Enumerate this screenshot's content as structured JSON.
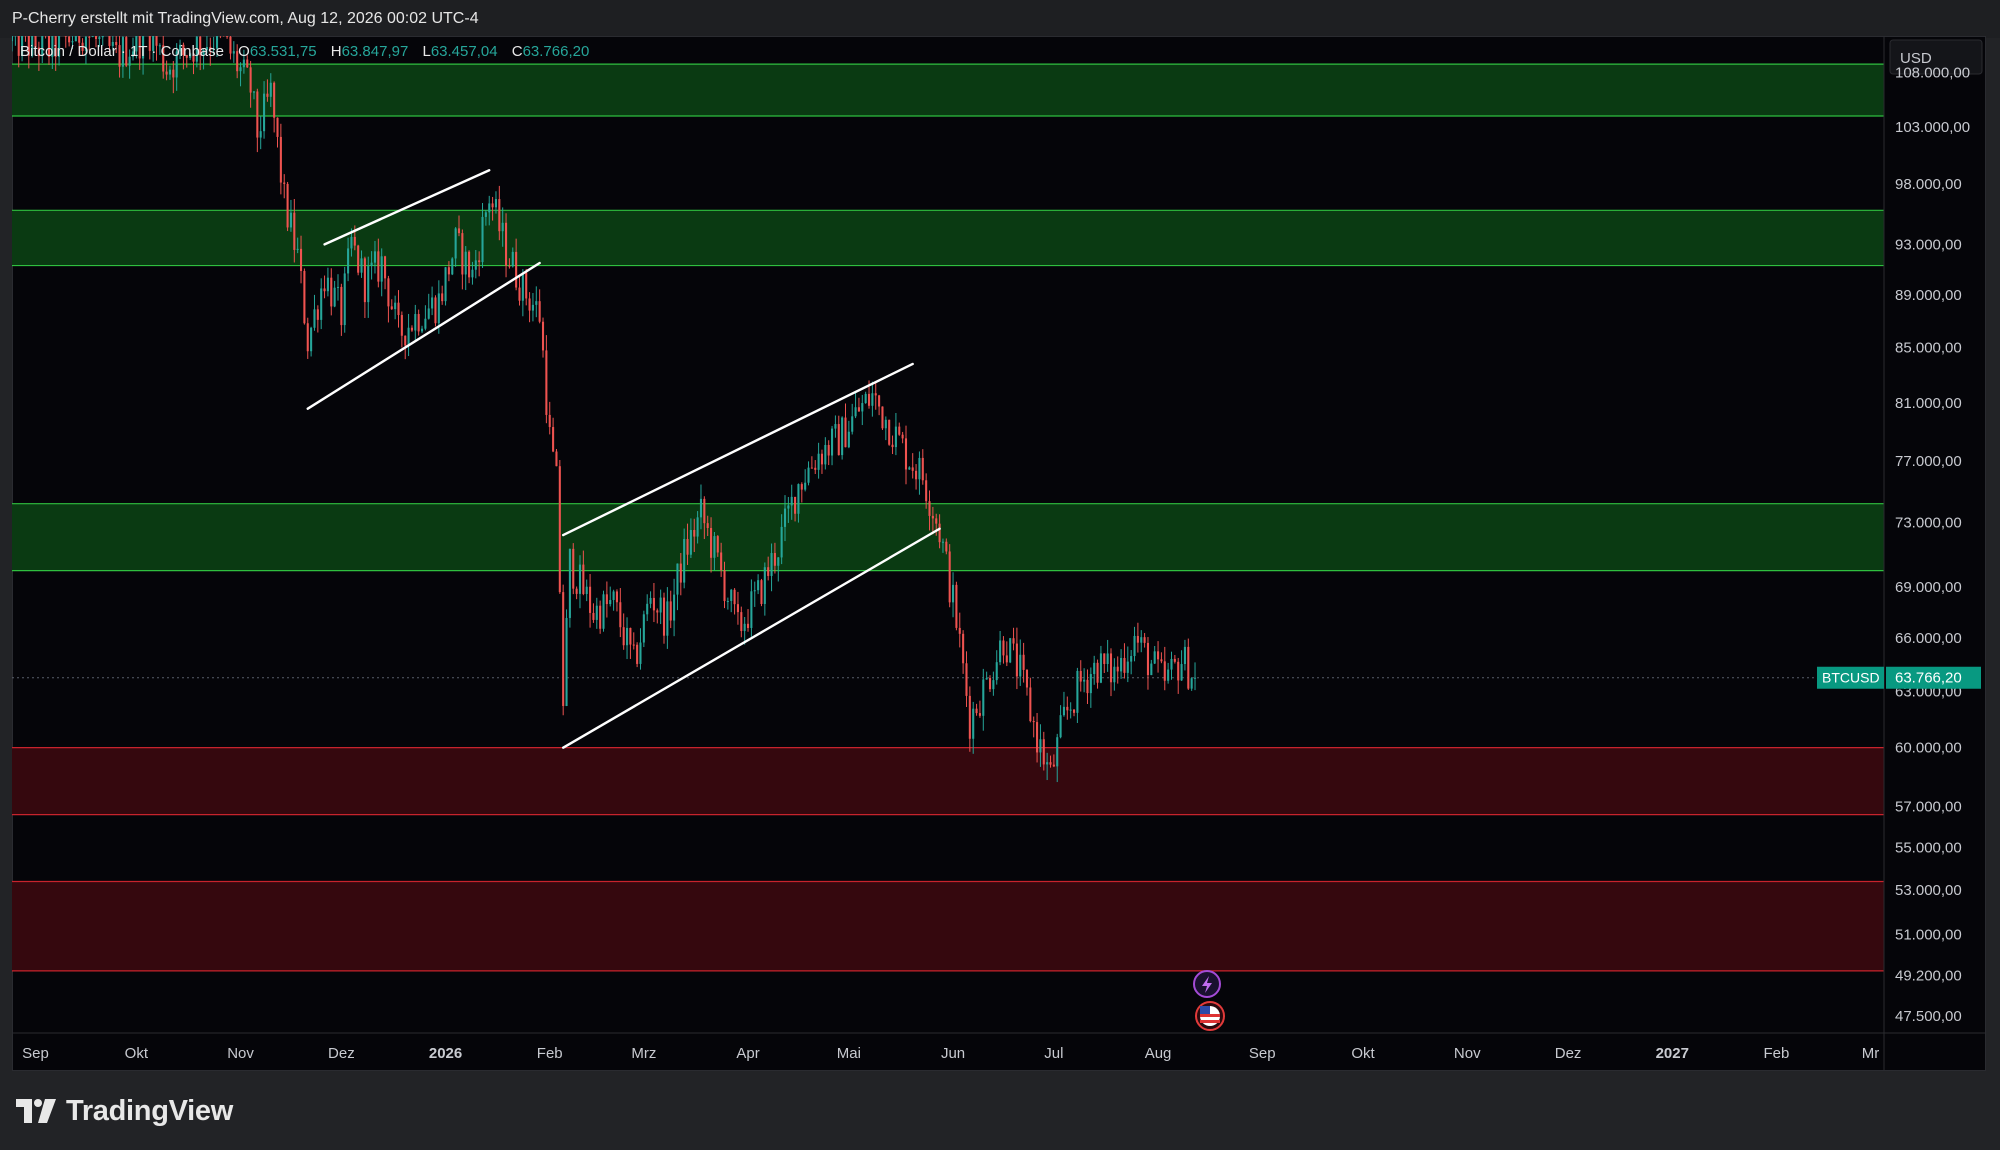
{
  "header": {
    "title": "P-Cherry erstellt mit TradingView.com, Aug 12, 2026 00:02 UTC-4"
  },
  "legend": {
    "symbol": "Bitcoin / Dollar · 1T · Coinbase",
    "o_label": "O",
    "o_value": "63.531,75",
    "h_label": "H",
    "h_value": "63.847,97",
    "l_label": "L",
    "l_value": "63.457,04",
    "c_label": "C",
    "c_value": "63.766,20"
  },
  "currency_label": "USD",
  "price_tag": {
    "symbol": "BTCUSD",
    "value": "63.766,20"
  },
  "brand": {
    "name": "TradingView"
  },
  "colors": {
    "up": "#26a69a",
    "down": "#ef5350",
    "support_zone": "#0a3a12",
    "support_border": "#2fbf3f",
    "resistance_zone": "#35080e",
    "resistance_border": "#c8232c",
    "tag_bg": "#089981"
  },
  "chart_data": {
    "type": "candlestick",
    "y_scale": "log",
    "ylim": [
      46800,
      111500
    ],
    "y_ticks": [
      {
        "value": 108000,
        "label": "108.000,00"
      },
      {
        "value": 103000,
        "label": "103.000,00"
      },
      {
        "value": 98000,
        "label": "98.000,00"
      },
      {
        "value": 93000,
        "label": "93.000,00"
      },
      {
        "value": 89000,
        "label": "89.000,00"
      },
      {
        "value": 85000,
        "label": "85.000,00"
      },
      {
        "value": 81000,
        "label": "81.000,00"
      },
      {
        "value": 77000,
        "label": "77.000,00"
      },
      {
        "value": 73000,
        "label": "73.000,00"
      },
      {
        "value": 69000,
        "label": "69.000,00"
      },
      {
        "value": 66000,
        "label": "66.000,00"
      },
      {
        "value": 63000,
        "label": "63.000,00"
      },
      {
        "value": 60000,
        "label": "60.000,00"
      },
      {
        "value": 57000,
        "label": "57.000,00"
      },
      {
        "value": 55000,
        "label": "55.000,00"
      },
      {
        "value": 53000,
        "label": "53.000,00"
      },
      {
        "value": 51000,
        "label": "51.000,00"
      },
      {
        "value": 49200,
        "label": "49.200,00"
      },
      {
        "value": 47500,
        "label": "47.500,00"
      }
    ],
    "x_range": [
      "2025-08-25",
      "2027-03-05"
    ],
    "x_ticks": [
      {
        "date": "2025-09-01",
        "label": "Sep",
        "bold": false
      },
      {
        "date": "2025-10-01",
        "label": "Okt",
        "bold": false
      },
      {
        "date": "2025-11-01",
        "label": "Nov",
        "bold": false
      },
      {
        "date": "2025-12-01",
        "label": "Dez",
        "bold": false
      },
      {
        "date": "2026-01-01",
        "label": "2026",
        "bold": true
      },
      {
        "date": "2026-02-01",
        "label": "Feb",
        "bold": false
      },
      {
        "date": "2026-03-01",
        "label": "Mrz",
        "bold": false
      },
      {
        "date": "2026-04-01",
        "label": "Apr",
        "bold": false
      },
      {
        "date": "2026-05-01",
        "label": "Mai",
        "bold": false
      },
      {
        "date": "2026-06-01",
        "label": "Jun",
        "bold": false
      },
      {
        "date": "2026-07-01",
        "label": "Jul",
        "bold": false
      },
      {
        "date": "2026-08-01",
        "label": "Aug",
        "bold": false
      },
      {
        "date": "2026-09-01",
        "label": "Sep",
        "bold": false
      },
      {
        "date": "2026-10-01",
        "label": "Okt",
        "bold": false
      },
      {
        "date": "2026-11-01",
        "label": "Nov",
        "bold": false
      },
      {
        "date": "2026-12-01",
        "label": "Dez",
        "bold": false
      },
      {
        "date": "2027-01-01",
        "label": "2027",
        "bold": true
      },
      {
        "date": "2027-02-01",
        "label": "Feb",
        "bold": false
      },
      {
        "date": "2027-03-01",
        "label": "Mr",
        "bold": false
      }
    ],
    "last_price": 63766.2,
    "zones": [
      {
        "kind": "support",
        "low": 104000,
        "high": 108800
      },
      {
        "kind": "support",
        "low": 91300,
        "high": 95800
      },
      {
        "kind": "support",
        "low": 70000,
        "high": 74200
      },
      {
        "kind": "resistance",
        "low": 56600,
        "high": 60000
      },
      {
        "kind": "resistance",
        "low": 49400,
        "high": 53400
      }
    ],
    "trendlines": [
      {
        "from": {
          "date": "2025-11-21",
          "value": 80600
        },
        "to": {
          "date": "2026-01-29",
          "value": 91500
        }
      },
      {
        "from": {
          "date": "2025-11-26",
          "value": 93000
        },
        "to": {
          "date": "2026-01-14",
          "value": 99200
        }
      },
      {
        "from": {
          "date": "2026-02-05",
          "value": 60000
        },
        "to": {
          "date": "2026-05-28",
          "value": 72600
        }
      },
      {
        "from": {
          "date": "2026-02-05",
          "value": 72200
        },
        "to": {
          "date": "2026-05-20",
          "value": 83800
        }
      }
    ],
    "path_points": [
      {
        "date": "2025-08-25",
        "value": 111000
      },
      {
        "date": "2025-09-05",
        "value": 110200
      },
      {
        "date": "2025-09-15",
        "value": 112000
      },
      {
        "date": "2025-09-25",
        "value": 109500
      },
      {
        "date": "2025-10-05",
        "value": 112000
      },
      {
        "date": "2025-10-10",
        "value": 108500
      },
      {
        "date": "2025-10-18",
        "value": 110500
      },
      {
        "date": "2025-10-26",
        "value": 111500
      },
      {
        "date": "2025-11-04",
        "value": 106500
      },
      {
        "date": "2025-11-06",
        "value": 102500
      },
      {
        "date": "2025-11-10",
        "value": 106000
      },
      {
        "date": "2025-11-14",
        "value": 96500
      },
      {
        "date": "2025-11-18",
        "value": 92000
      },
      {
        "date": "2025-11-21",
        "value": 85500
      },
      {
        "date": "2025-11-26",
        "value": 90500
      },
      {
        "date": "2025-12-01",
        "value": 87500
      },
      {
        "date": "2025-12-04",
        "value": 93000
      },
      {
        "date": "2025-12-08",
        "value": 90000
      },
      {
        "date": "2025-12-13",
        "value": 91500
      },
      {
        "date": "2025-12-18",
        "value": 86000
      },
      {
        "date": "2025-12-24",
        "value": 87500
      },
      {
        "date": "2025-12-30",
        "value": 88500
      },
      {
        "date": "2026-01-04",
        "value": 93000
      },
      {
        "date": "2026-01-09",
        "value": 90500
      },
      {
        "date": "2026-01-14",
        "value": 97000
      },
      {
        "date": "2026-01-19",
        "value": 92500
      },
      {
        "date": "2026-01-24",
        "value": 89500
      },
      {
        "date": "2026-01-29",
        "value": 87500
      },
      {
        "date": "2026-02-01",
        "value": 78500
      },
      {
        "date": "2026-02-03",
        "value": 75500
      },
      {
        "date": "2026-02-05",
        "value": 62500
      },
      {
        "date": "2026-02-07",
        "value": 70500
      },
      {
        "date": "2026-02-14",
        "value": 67500
      },
      {
        "date": "2026-02-20",
        "value": 68000
      },
      {
        "date": "2026-02-26",
        "value": 64500
      },
      {
        "date": "2026-03-03",
        "value": 68500
      },
      {
        "date": "2026-03-08",
        "value": 67000
      },
      {
        "date": "2026-03-13",
        "value": 71000
      },
      {
        "date": "2026-03-18",
        "value": 73500
      },
      {
        "date": "2026-03-23",
        "value": 70500
      },
      {
        "date": "2026-03-29",
        "value": 66500
      },
      {
        "date": "2026-04-04",
        "value": 68500
      },
      {
        "date": "2026-04-10",
        "value": 71500
      },
      {
        "date": "2026-04-16",
        "value": 75500
      },
      {
        "date": "2026-04-22",
        "value": 77500
      },
      {
        "date": "2026-04-28",
        "value": 78500
      },
      {
        "date": "2026-05-04",
        "value": 80500
      },
      {
        "date": "2026-05-08",
        "value": 81500
      },
      {
        "date": "2026-05-13",
        "value": 79500
      },
      {
        "date": "2026-05-18",
        "value": 77500
      },
      {
        "date": "2026-05-23",
        "value": 76000
      },
      {
        "date": "2026-05-28",
        "value": 72500
      },
      {
        "date": "2026-06-02",
        "value": 67000
      },
      {
        "date": "2026-06-06",
        "value": 61500
      },
      {
        "date": "2026-06-11",
        "value": 63500
      },
      {
        "date": "2026-06-16",
        "value": 66000
      },
      {
        "date": "2026-06-21",
        "value": 64000
      },
      {
        "date": "2026-06-26",
        "value": 60500
      },
      {
        "date": "2026-06-30",
        "value": 58500
      },
      {
        "date": "2026-07-04",
        "value": 61500
      },
      {
        "date": "2026-07-09",
        "value": 63500
      },
      {
        "date": "2026-07-14",
        "value": 64500
      },
      {
        "date": "2026-07-19",
        "value": 64000
      },
      {
        "date": "2026-07-25",
        "value": 66000
      },
      {
        "date": "2026-07-29",
        "value": 64800
      },
      {
        "date": "2026-08-03",
        "value": 63500
      },
      {
        "date": "2026-08-08",
        "value": 64800
      },
      {
        "date": "2026-08-12",
        "value": 63766
      }
    ]
  }
}
